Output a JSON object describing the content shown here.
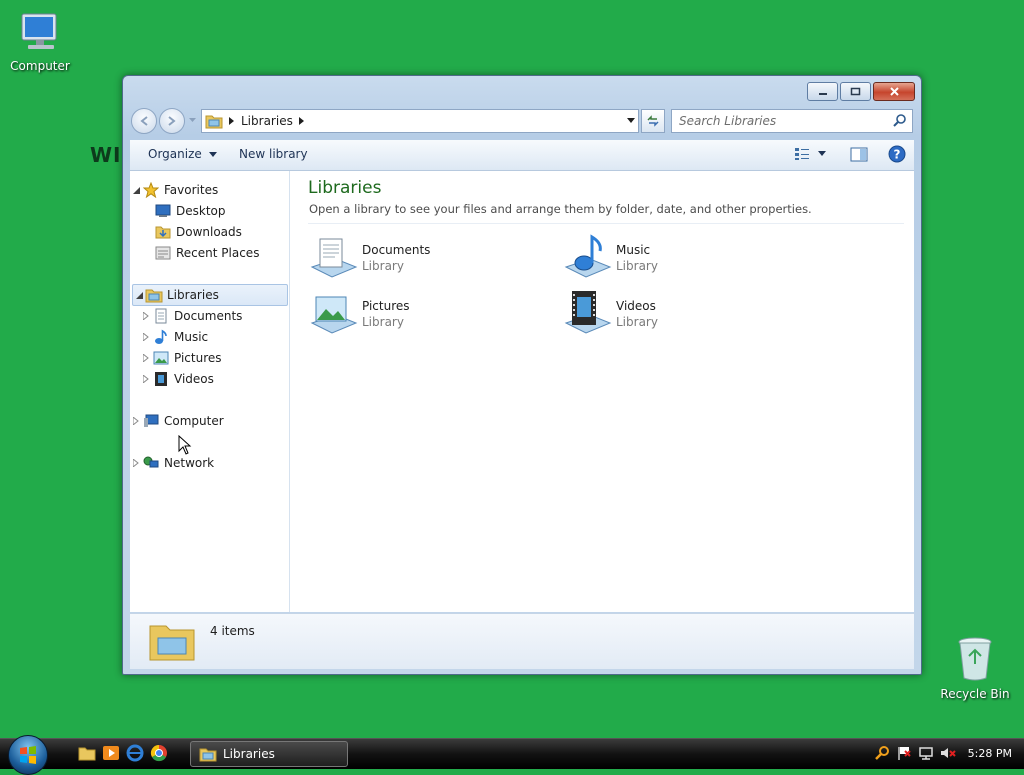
{
  "desktop": {
    "computer_label": "Computer",
    "recycle_label": "Recycle Bin",
    "wallpaper_text": "WI"
  },
  "window": {
    "address": {
      "crumb": "Libraries"
    },
    "search": {
      "placeholder": "Search Libraries"
    },
    "toolbar": {
      "organize": "Organize",
      "new_library": "New library"
    },
    "nav": {
      "favorites": {
        "label": "Favorites",
        "items": [
          "Desktop",
          "Downloads",
          "Recent Places"
        ]
      },
      "libraries": {
        "label": "Libraries",
        "items": [
          "Documents",
          "Music",
          "Pictures",
          "Videos"
        ]
      },
      "computer": "Computer",
      "network": "Network"
    },
    "main": {
      "title": "Libraries",
      "subtitle": "Open a library to see your files and arrange them by folder, date, and other properties.",
      "tiles": [
        {
          "name": "Documents",
          "type": "Library",
          "icon": "documents-library-icon"
        },
        {
          "name": "Music",
          "type": "Library",
          "icon": "music-library-icon"
        },
        {
          "name": "Pictures",
          "type": "Library",
          "icon": "pictures-library-icon"
        },
        {
          "name": "Videos",
          "type": "Library",
          "icon": "videos-library-icon"
        }
      ]
    },
    "details": {
      "count": "4 items"
    }
  },
  "taskbar": {
    "task_label": "Libraries",
    "clock": "5:28 PM"
  },
  "colors": {
    "desktop_bg": "#22ab4a",
    "title_accent": "#1e6a1e",
    "selection": "#dbe8f7",
    "close_button": "#c6452d"
  }
}
